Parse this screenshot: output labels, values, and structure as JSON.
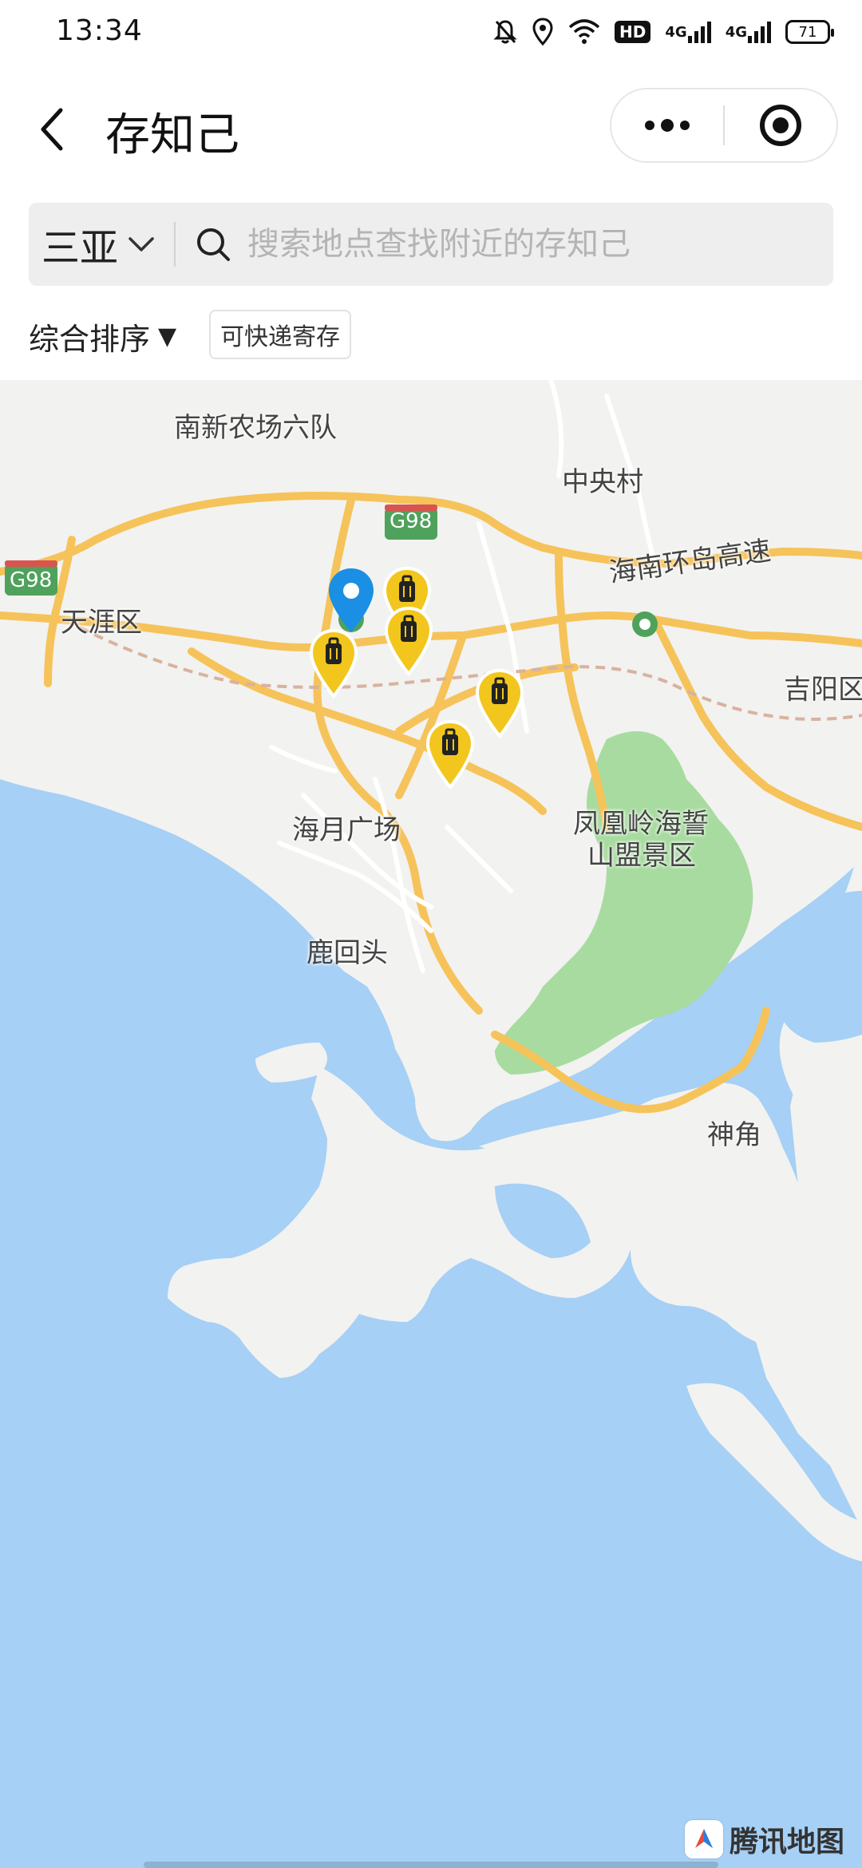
{
  "status_bar": {
    "time": "13:34",
    "icons": [
      "mute-icon",
      "location-icon",
      "wifi-icon",
      "hd-icon",
      "signal-icon",
      "signal-icon",
      "battery-icon"
    ],
    "hd_label": "HD",
    "network_1": "4G",
    "network_2": "4G",
    "battery_level": "71"
  },
  "header": {
    "title": "存知己",
    "back_icon": "chevron-left-icon",
    "more_icon": "more-dots-icon",
    "close_icon": "target-circle-icon"
  },
  "search": {
    "city": "三亚",
    "placeholder": "搜索地点查找附近的存知己"
  },
  "filters": {
    "sort_label": "综合排序",
    "sort_arrow": "▼",
    "express_chip": "可快递寄存"
  },
  "map": {
    "labels": {
      "nanxin": "南新农场六队",
      "zhongyang": "中央村",
      "g98_a": "G98",
      "g98_b": "G98",
      "huandao": "海南环岛高速",
      "tianya": "天涯区",
      "jiyang": "吉阳区",
      "haiyue": "海月广场",
      "fenghuang_1": "凤凰岭海誓",
      "fenghuang_2": "山盟景区",
      "luhuitou": "鹿回头",
      "shenjiao": "神角"
    },
    "storage_markers": 5,
    "colors": {
      "sea": "#a6d0f5",
      "land": "#f2f2f0",
      "park": "#a8dba0",
      "road_major": "#f6c35a",
      "road_minor": "#ffffff",
      "marker_yellow": "#f2c61d",
      "pin_blue": "#1a8fe3"
    }
  },
  "logo": {
    "text": "腾讯地图"
  }
}
